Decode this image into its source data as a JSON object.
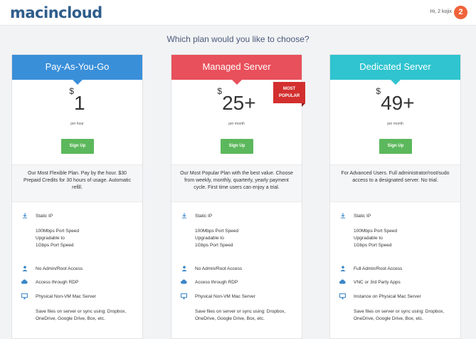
{
  "header": {
    "logo": "macincloud",
    "greeting": "Hi, 2 kojix",
    "notification_count": "2"
  },
  "question": "Which plan would you like to choose?",
  "plans": [
    {
      "name": "Pay-As-You-Go",
      "color": "#3a8fd9",
      "currency": "$",
      "price": "1",
      "per": "per hour",
      "signup": "Sign Up",
      "description": "Our Most Flexible Plan. Pay by the hour. $30 Prepaid Credits for 30 hours of usage. Automatic refill.",
      "features": {
        "f1": "Static IP",
        "speed1": "100Mbps Port Speed",
        "speed2": "Upgradable to",
        "speed3": "1Gbps Port Speed",
        "f2": "No Admin/Root Access",
        "f3": "Access through RDP",
        "f4": "Physical Non-VM Mac Server",
        "save": "Save files on server or sync using: Dropbox, OneDrive, Google Drive, Box, etc."
      }
    },
    {
      "name": "Managed Server",
      "color": "#e8505b",
      "currency": "$",
      "price": "25+",
      "per": "per month",
      "signup": "Sign Up",
      "badge": "MOST POPULAR",
      "description": "Our Most Popular Plan with the best value. Choose from weekly, monthly, quarterly, yearly payment cycle. First time users can enjoy a trial.",
      "features": {
        "f1": "Static IP",
        "speed1": "100Mbps Port Speed",
        "speed2": "Upgradable to",
        "speed3": "1Gbps Port Speed",
        "f2": "No Admin/Root Access",
        "f3": "Access through RDP",
        "f4": "Physical Non-VM Mac Server",
        "save": "Save files on server or sync using: Dropbox, OneDrive, Google Drive, Box, etc."
      }
    },
    {
      "name": "Dedicated Server",
      "color": "#2fc4cf",
      "currency": "$",
      "price": "49+",
      "per": "per month",
      "signup": "Sign Up",
      "description": "For Advanced Users. Full administrator/root/sudo access to a designated server. No trial.",
      "features": {
        "f1": "Static IP",
        "speed1": "100Mbps Port Speed",
        "speed2": "Upgradable to",
        "speed3": "1Gbps Port Speed",
        "f2": "Full Admin/Root Access",
        "f3": "VNC or 3rd Party Apps",
        "f4": "Instance on Physical Mac Server",
        "save": "Save files on server or sync using: Dropbox, OneDrive, Google Drive, Box, etc."
      }
    }
  ],
  "icons": {
    "static_ip": "download-icon",
    "admin": "user-icon",
    "access": "cloud-icon",
    "server": "monitor-icon"
  }
}
